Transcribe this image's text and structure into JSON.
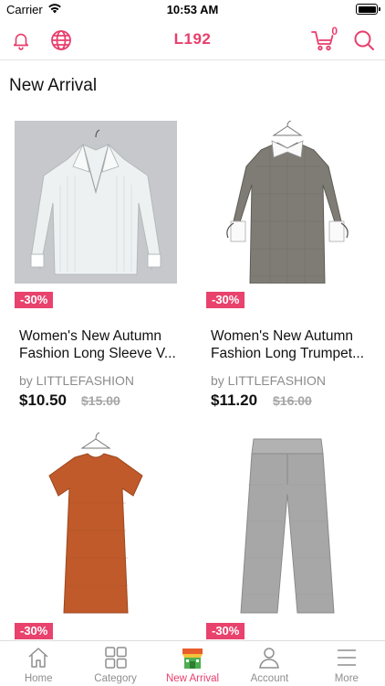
{
  "status_bar": {
    "carrier": "Carrier",
    "time": "10:53 AM"
  },
  "nav": {
    "title": "L192",
    "cart_count": "0"
  },
  "section": {
    "title": "New Arrival"
  },
  "products": [
    {
      "discount": "-30%",
      "title_line1": "Women's New Autumn",
      "title_line2": "Fashion Long Sleeve V...",
      "seller": "by LITTLEFASHION",
      "price": "$10.50",
      "old_price": "$15.00",
      "image": "white-striped-blouse"
    },
    {
      "discount": "-30%",
      "title_line1": "Women's New Autumn",
      "title_line2": "Fashion Long Trumpet...",
      "seller": "by LITTLEFASHION",
      "price": "$11.20",
      "old_price": "$16.00",
      "image": "grey-plaid-dress"
    },
    {
      "discount": "-30%",
      "image": "rust-tshirt-dress"
    },
    {
      "discount": "-30%",
      "image": "grey-trousers"
    }
  ],
  "tabs": [
    {
      "label": "Home",
      "icon": "home-icon"
    },
    {
      "label": "Category",
      "icon": "category-grid-icon"
    },
    {
      "label": "New Arrival",
      "icon": "new-arrival-shop-icon",
      "active": true
    },
    {
      "label": "Account",
      "icon": "person-icon"
    },
    {
      "label": "More",
      "icon": "menu-icon"
    }
  ],
  "colors": {
    "accent": "#e83e6c",
    "discount_bg": "#e8426d"
  }
}
